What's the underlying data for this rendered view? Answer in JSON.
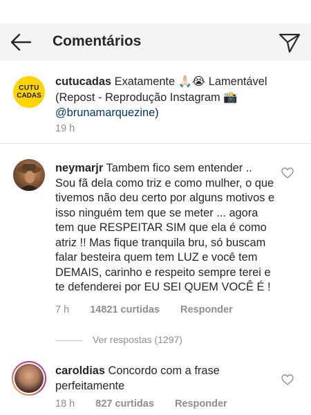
{
  "header": {
    "title": "Comentários",
    "back_icon": "back-arrow-icon",
    "send_icon": "direct-send-icon"
  },
  "caption": {
    "avatar_text": [
      "CUTU",
      "CADAS"
    ],
    "username": "cutucadas",
    "text_before_mention": " Exatamente 🙏🏻😭 Lamentável (Repost - Reprodução Instagram 📸 ",
    "mention": "@brunamarquezine",
    "text_after_mention": ")",
    "time": "19 h"
  },
  "comments": [
    {
      "username": "neymarjr",
      "text": " Tambem fico sem entender .. Sou fã dela como triz e como mulher, o que tivemos não deu certo por alguns motivos e isso ninguém tem que se meter ... agora tem que RESPEITAR SIM que ela é como atriz !! Mas fique tranquila bru, só buscam falar besteira quem tem LUZ e você tem DEMAIS, carinho e respeito sempre terei e te defenderei por EU SEI QUEM VOCÊ É !",
      "time": "7 h",
      "likes": "14821 curtidas",
      "reply": "Responder",
      "view_replies": "Ver respostas (1297)"
    },
    {
      "username": "caroldias",
      "text": " Concordo com a frase perfeitamente",
      "time": "18 h",
      "likes": "827 curtidas",
      "reply": "Responder"
    }
  ],
  "colors": {
    "text": "#262626",
    "secondary": "#8e8e8e",
    "mention": "#00376b",
    "header_bg": "#f4f4f4",
    "avatar_yellow": "#ffd400"
  }
}
